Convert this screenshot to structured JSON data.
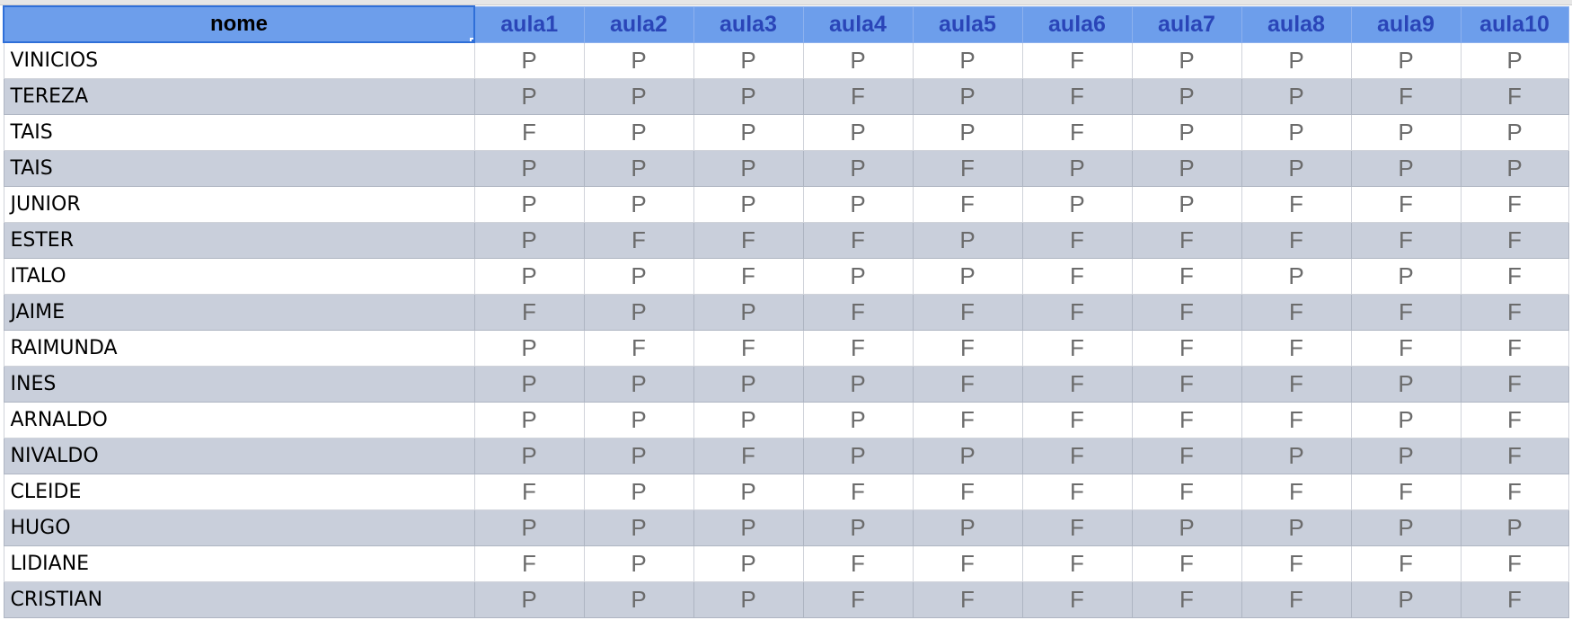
{
  "sheet": {
    "headers": [
      "nome",
      "aula1",
      "aula2",
      "aula3",
      "aula4",
      "aula5",
      "aula6",
      "aula7",
      "aula8",
      "aula9",
      "aula10"
    ],
    "rows": [
      {
        "name": "VINICIOS",
        "marks": [
          "P",
          "P",
          "P",
          "P",
          "P",
          "F",
          "P",
          "P",
          "P",
          "P"
        ]
      },
      {
        "name": "TEREZA",
        "marks": [
          "P",
          "P",
          "P",
          "F",
          "P",
          "F",
          "P",
          "P",
          "F",
          "F"
        ]
      },
      {
        "name": "TAIS",
        "marks": [
          "F",
          "P",
          "P",
          "P",
          "P",
          "F",
          "P",
          "P",
          "P",
          "P"
        ]
      },
      {
        "name": "TAIS",
        "marks": [
          "P",
          "P",
          "P",
          "P",
          "F",
          "P",
          "P",
          "P",
          "P",
          "P"
        ]
      },
      {
        "name": "JUNIOR",
        "marks": [
          "P",
          "P",
          "P",
          "P",
          "F",
          "P",
          "P",
          "F",
          "F",
          "F"
        ]
      },
      {
        "name": "ESTER",
        "marks": [
          "P",
          "F",
          "F",
          "F",
          "P",
          "F",
          "F",
          "F",
          "F",
          "F"
        ]
      },
      {
        "name": "ITALO",
        "marks": [
          "P",
          "P",
          "F",
          "P",
          "P",
          "F",
          "F",
          "P",
          "P",
          "F"
        ]
      },
      {
        "name": "JAIME",
        "marks": [
          "F",
          "P",
          "P",
          "F",
          "F",
          "F",
          "F",
          "F",
          "F",
          "F"
        ]
      },
      {
        "name": "RAIMUNDA",
        "marks": [
          "P",
          "F",
          "F",
          "F",
          "F",
          "F",
          "F",
          "F",
          "F",
          "F"
        ]
      },
      {
        "name": "INES",
        "marks": [
          "P",
          "P",
          "P",
          "P",
          "F",
          "F",
          "F",
          "F",
          "P",
          "F"
        ]
      },
      {
        "name": "ARNALDO",
        "marks": [
          "P",
          "P",
          "P",
          "P",
          "F",
          "F",
          "F",
          "F",
          "P",
          "F"
        ]
      },
      {
        "name": "NIVALDO",
        "marks": [
          "P",
          "P",
          "F",
          "P",
          "P",
          "F",
          "F",
          "P",
          "P",
          "F"
        ]
      },
      {
        "name": "CLEIDE",
        "marks": [
          "F",
          "P",
          "P",
          "F",
          "F",
          "F",
          "F",
          "F",
          "F",
          "F"
        ]
      },
      {
        "name": "HUGO",
        "marks": [
          "P",
          "P",
          "P",
          "P",
          "P",
          "F",
          "P",
          "P",
          "P",
          "P"
        ]
      },
      {
        "name": "LIDIANE",
        "marks": [
          "F",
          "P",
          "P",
          "F",
          "F",
          "F",
          "F",
          "F",
          "F",
          "F"
        ]
      },
      {
        "name": "CRISTIAN",
        "marks": [
          "P",
          "P",
          "P",
          "F",
          "F",
          "F",
          "F",
          "F",
          "P",
          "F"
        ]
      }
    ]
  },
  "colors": {
    "header_bg": "#6d9eeb",
    "header_text": "#2a45b8",
    "band_row": "#c9cfdb",
    "selection": "#2f6fd8",
    "mark_text": "#6b6b6b"
  }
}
